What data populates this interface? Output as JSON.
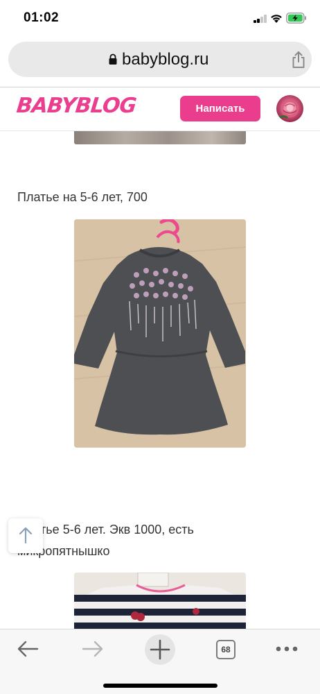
{
  "status_bar": {
    "time": "01:02"
  },
  "address_bar": {
    "url": "babyblog.ru"
  },
  "site_header": {
    "logo_text": "BABYBLOG",
    "write_button_label": "Написать"
  },
  "posts": [
    {
      "caption": "Платье на 5-6 лет, 700"
    },
    {
      "caption": "Платье 5-6 лет. Экв 1000, есть микропятнышко"
    }
  ],
  "toolbar": {
    "tab_count": "68"
  },
  "colors": {
    "brand_pink": "#ea3d8d",
    "address_bar_bg": "#e9e9ea",
    "toolbar_bg": "#f7f7f7"
  },
  "icons": [
    "lock-icon",
    "share-icon",
    "back-to-top-icon",
    "back-arrow-icon",
    "forward-arrow-icon",
    "plus-icon",
    "tabs-icon",
    "more-icon",
    "wifi-icon",
    "battery-icon",
    "signal-icon"
  ]
}
